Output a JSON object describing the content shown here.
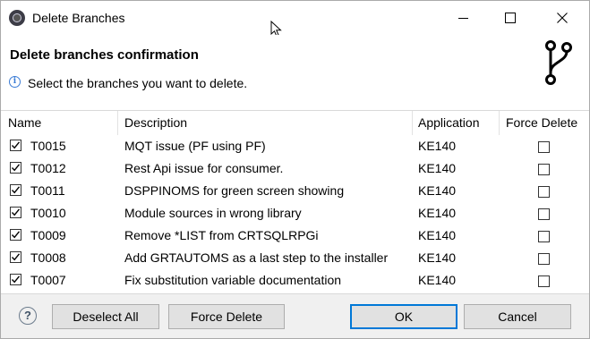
{
  "window": {
    "title": "Delete Branches"
  },
  "header": {
    "title": "Delete branches confirmation",
    "message": "Select the branches you want to delete."
  },
  "table": {
    "columns": [
      "Name",
      "Description",
      "Application",
      "Force Delete"
    ],
    "rows": [
      {
        "name": "T0015",
        "description": "MQT issue (PF using PF)",
        "application": "KE140",
        "selected": true,
        "force": false
      },
      {
        "name": "T0012",
        "description": "Rest Api issue for consumer.",
        "application": "KE140",
        "selected": true,
        "force": false
      },
      {
        "name": "T0011",
        "description": "DSPPINOMS for green screen showing",
        "application": "KE140",
        "selected": true,
        "force": false
      },
      {
        "name": "T0010",
        "description": "Module sources in wrong library",
        "application": "KE140",
        "selected": true,
        "force": false
      },
      {
        "name": "T0009",
        "description": "Remove *LIST from CRTSQLRPGi",
        "application": "KE140",
        "selected": true,
        "force": false
      },
      {
        "name": "T0008",
        "description": "Add GRTAUTOMS as a last step to the installer",
        "application": "KE140",
        "selected": true,
        "force": false
      },
      {
        "name": "T0007",
        "description": "Fix substitution variable documentation",
        "application": "KE140",
        "selected": true,
        "force": false
      }
    ]
  },
  "buttons": {
    "help": "?",
    "deselect_all": "Deselect All",
    "force_delete": "Force Delete",
    "ok": "OK",
    "cancel": "Cancel"
  },
  "icons": {
    "app": "eclipse-app-icon",
    "info": "info-icon",
    "branch": "git-branch-icon",
    "cursor": "mouse-cursor-icon"
  },
  "colors": {
    "accent": "#0078d7",
    "info": "#3a7bd5"
  }
}
